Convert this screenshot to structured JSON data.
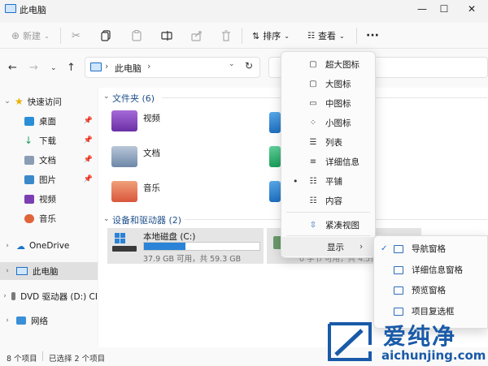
{
  "window": {
    "title": "此电脑",
    "minimize_glyph": "—",
    "maximize_glyph": "☐",
    "close_glyph": "✕"
  },
  "toolbar": {
    "new_label": "新建",
    "sort_label": "排序",
    "view_label": "查看",
    "more_glyph": "···"
  },
  "address": {
    "location": "此电脑",
    "separator": "›"
  },
  "sidebar": {
    "items": [
      {
        "label": "快速访问"
      },
      {
        "label": "桌面"
      },
      {
        "label": "下载"
      },
      {
        "label": "文档"
      },
      {
        "label": "图片"
      },
      {
        "label": "视频"
      },
      {
        "label": "音乐"
      },
      {
        "label": "OneDrive"
      },
      {
        "label": "此电脑"
      },
      {
        "label": "DVD 驱动器 (D:) CI"
      },
      {
        "label": "网络"
      }
    ]
  },
  "main": {
    "folders_header": "文件夹 (6)",
    "folders": [
      {
        "label": "视频"
      },
      {
        "label": "文档"
      },
      {
        "label": "音乐"
      }
    ],
    "devices_header": "设备和驱动器 (2)",
    "drive": {
      "name": "本地磁盘 (C:)",
      "usage_text": "37.9 GB 可用，共 59.3 GB",
      "used_fraction": 0.36
    },
    "drive2_partial_text": "0 字节 可用，共 4.59"
  },
  "status": {
    "item_count": "8 个项目",
    "selected": "已选择 2 个项目"
  },
  "view_menu": {
    "items": [
      {
        "label": "超大图标"
      },
      {
        "label": "大图标"
      },
      {
        "label": "中图标"
      },
      {
        "label": "小图标"
      },
      {
        "label": "列表"
      },
      {
        "label": "详细信息"
      },
      {
        "label": "平铺"
      },
      {
        "label": "内容"
      },
      {
        "label": "紧凑视图"
      },
      {
        "label": "显示"
      }
    ],
    "bullet_glyph": "•",
    "arrow_glyph": "›"
  },
  "show_submenu": {
    "items": [
      {
        "label": "导航窗格",
        "checked": true
      },
      {
        "label": "详细信息窗格",
        "checked": false
      },
      {
        "label": "预览窗格",
        "checked": false
      },
      {
        "label": "项目复选框",
        "checked": false
      }
    ],
    "check_glyph": "✓"
  },
  "watermark": {
    "brand": "爱纯净",
    "url": "aichunjing.com"
  },
  "colors": {
    "accent": "#1f6fc5",
    "drive_bar": "#2a83d6",
    "group_header": "#1f4f8a"
  }
}
